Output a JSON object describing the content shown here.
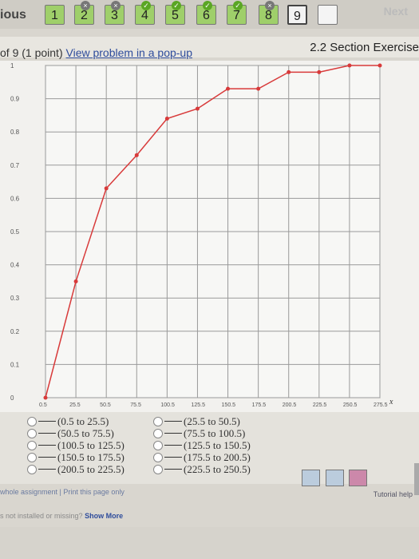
{
  "nav": {
    "prev_label": "ious",
    "next_label": "Next",
    "questions": [
      {
        "label": "1",
        "state": "done"
      },
      {
        "label": "2",
        "state": "wrong"
      },
      {
        "label": "3",
        "state": "wrong"
      },
      {
        "label": "4",
        "state": "done"
      },
      {
        "label": "5",
        "state": "done"
      },
      {
        "label": "6",
        "state": "done"
      },
      {
        "label": "7",
        "state": "done"
      },
      {
        "label": "8",
        "state": "wrong"
      },
      {
        "label": "9",
        "state": "current"
      },
      {
        "label": "",
        "state": "empty"
      }
    ]
  },
  "question": {
    "progress": "of 9 (1 point)",
    "popup_link": "View problem in a pop-up",
    "section": "2.2 Section Exercise"
  },
  "chart_data": {
    "type": "line",
    "x": [
      0.5,
      25.5,
      50.5,
      75.5,
      100.5,
      125.5,
      150.5,
      175.5,
      200.5,
      225.5,
      250.5,
      275.5
    ],
    "y": [
      0,
      0.35,
      0.63,
      0.73,
      0.84,
      0.87,
      0.93,
      0.93,
      0.98,
      0.98,
      1.0,
      1.0
    ],
    "x_ticks": [
      "0.5",
      "25.5",
      "50.5",
      "75.5",
      "100.5",
      "125.5",
      "150.5",
      "175.5",
      "200.5",
      "225.5",
      "250.5",
      "275.5"
    ],
    "y_ticks": [
      "0",
      "0.1",
      "0.2",
      "0.3",
      "0.4",
      "0.5",
      "0.6",
      "0.7",
      "0.8",
      "0.9",
      "1"
    ],
    "xlabel": "x",
    "ylim": [
      0,
      1
    ],
    "grid": true,
    "color": "#d83a3a"
  },
  "options_left": [
    "(0.5 to 25.5)",
    "(50.5 to 75.5)",
    "(100.5 to 125.5)",
    "(150.5 to 175.5)",
    "(200.5 to 225.5)"
  ],
  "options_right": [
    "(25.5 to 50.5)",
    "(75.5 to 100.5)",
    "(125.5 to 150.5)",
    "(175.5 to 200.5)",
    "(225.5 to 250.5)"
  ],
  "footer": {
    "links": "whole assignment | Print this page only",
    "tutorial": "Tutorial help",
    "missing": "s not installed or missing?",
    "show_more": "Show More"
  }
}
